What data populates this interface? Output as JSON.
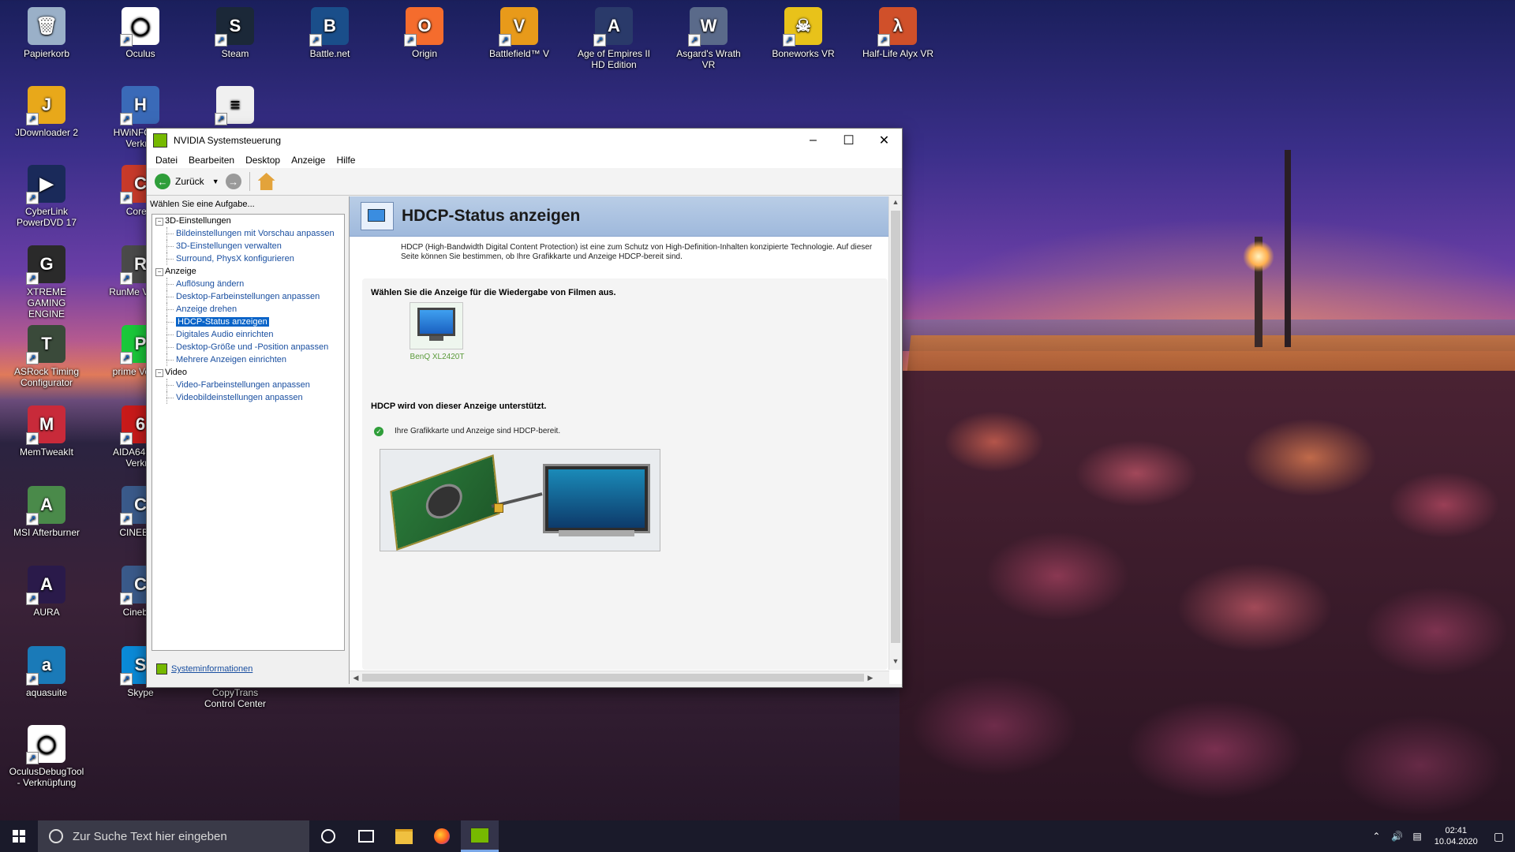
{
  "desktop": {
    "icons": [
      {
        "label": "Papierkorb",
        "color": "#9ab0c8",
        "glyph": "🗑"
      },
      {
        "label": "Oculus",
        "color": "#ffffff",
        "glyph": "◯"
      },
      {
        "label": "Steam",
        "color": "#1b2838",
        "glyph": "S"
      },
      {
        "label": "Battle.net",
        "color": "#1a4e8a",
        "glyph": "B"
      },
      {
        "label": "Origin",
        "color": "#f56c2d",
        "glyph": "O"
      },
      {
        "label": "Battlefield™ V",
        "color": "#e89a1a",
        "glyph": "V"
      },
      {
        "label": "Age of Empires II HD Edition",
        "color": "#2a3a6a",
        "glyph": "A"
      },
      {
        "label": "Asgard's Wrath VR",
        "color": "#5a6a8a",
        "glyph": "W"
      },
      {
        "label": "Boneworks VR",
        "color": "#e8c21a",
        "glyph": "☠"
      },
      {
        "label": "Half-Life Alyx VR",
        "color": "#d0502a",
        "glyph": "λ"
      },
      {
        "label": "JDownloader 2",
        "color": "#e8a81a",
        "glyph": "J"
      },
      {
        "label": "HWiNFO64 - Verknü",
        "color": "#3a6ab8",
        "glyph": "H"
      },
      {
        "label": "",
        "color": "#f0f0f0",
        "glyph": "≡"
      },
      {
        "label": "CyberLink PowerDVD 17",
        "color": "#1a2a5a",
        "glyph": "▶"
      },
      {
        "label": "Core T",
        "color": "#c83a2a",
        "glyph": "C"
      },
      {
        "label": "XTREME GAMING ENGINE",
        "color": "#2a2a2a",
        "glyph": "G"
      },
      {
        "label": "RunMe Verknü",
        "color": "#4a4a4a",
        "glyph": "R"
      },
      {
        "label": "ASRock Timing Configurator",
        "color": "#3a4a3a",
        "glyph": "T"
      },
      {
        "label": "prime Verknü",
        "color": "#1ac83a",
        "glyph": "P"
      },
      {
        "label": "MemTweakIt",
        "color": "#c82a3a",
        "glyph": "M"
      },
      {
        "label": "AIDA64Extr - Verknü",
        "color": "#c81a1a",
        "glyph": "6"
      },
      {
        "label": "MSI Afterburner",
        "color": "#4a8a4a",
        "glyph": "A"
      },
      {
        "label": "CINEBEN",
        "color": "#3a5a8a",
        "glyph": "C"
      },
      {
        "label": "AURA",
        "color": "#2a1a4a",
        "glyph": "A"
      },
      {
        "label": "Cineben",
        "color": "#3a5a8a",
        "glyph": "C"
      },
      {
        "label": "aquasuite",
        "color": "#1a7ab8",
        "glyph": "a"
      },
      {
        "label": "Skype",
        "color": "#0a8ad8",
        "glyph": "S"
      },
      {
        "label": "CopyTrans Control Center",
        "color": "#3a6ab8",
        "glyph": "C"
      },
      {
        "label": "OculusDebugTool - Verknüpfung",
        "color": "#ffffff",
        "glyph": "◯"
      }
    ]
  },
  "window": {
    "title": "NVIDIA Systemsteuerung",
    "menu": [
      "Datei",
      "Bearbeiten",
      "Desktop",
      "Anzeige",
      "Hilfe"
    ],
    "toolbar": {
      "back_label": "Zurück"
    },
    "left": {
      "task_label": "Wählen Sie eine Aufgabe...",
      "tree": [
        {
          "group": "3D-Einstellungen",
          "items": [
            "Bildeinstellungen mit Vorschau anpassen",
            "3D-Einstellungen verwalten",
            "Surround, PhysX konfigurieren"
          ]
        },
        {
          "group": "Anzeige",
          "items": [
            "Auflösung ändern",
            "Desktop-Farbeinstellungen anpassen",
            "Anzeige drehen",
            "HDCP-Status anzeigen",
            "Digitales Audio einrichten",
            "Desktop-Größe und -Position anpassen",
            "Mehrere Anzeigen einrichten"
          ]
        },
        {
          "group": "Video",
          "items": [
            "Video-Farbeinstellungen anpassen",
            "Videobildeinstellungen anpassen"
          ]
        }
      ],
      "selected": "HDCP-Status anzeigen",
      "sysinfo": "Systeminformationen"
    },
    "right": {
      "heading": "HDCP-Status anzeigen",
      "description": "HDCP (High-Bandwidth Digital Content Protection) ist eine zum Schutz von High-Definition-Inhalten konzipierte Technologie. Auf dieser Seite können Sie bestimmen, ob Ihre Grafikkarte und Anzeige HDCP-bereit sind.",
      "select_display": "Wählen Sie die Anzeige für die Wiedergabe von Filmen aus.",
      "monitor_name": "BenQ XL2420T",
      "hdcp_supported": "HDCP wird von dieser Anzeige unterstützt.",
      "hdcp_ready": "Ihre Grafikkarte und Anzeige sind HDCP-bereit."
    }
  },
  "taskbar": {
    "search_placeholder": "Zur Suche Text hier eingeben",
    "time": "02:41",
    "date": "10.04.2020"
  }
}
